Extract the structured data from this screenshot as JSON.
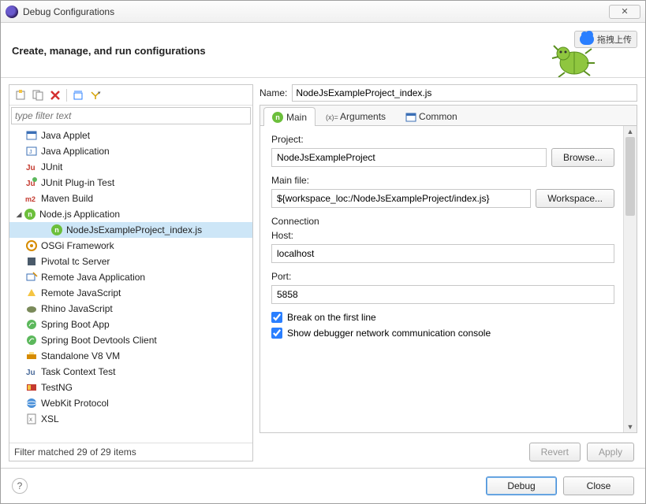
{
  "window": {
    "title": "Debug Configurations",
    "close_x": "✕"
  },
  "header": {
    "title": "Create, manage, and run configurations",
    "cloud_label": "拖拽上传"
  },
  "toolbar": {
    "new_tip": "new",
    "dup_tip": "duplicate",
    "del_tip": "delete",
    "collapse_tip": "collapse",
    "filter_tip": "filter"
  },
  "filter": {
    "placeholder": "type filter text"
  },
  "tree": {
    "items": [
      {
        "label": "Java Applet",
        "icon": "applet"
      },
      {
        "label": "Java Application",
        "icon": "java-app"
      },
      {
        "label": "JUnit",
        "icon": "junit"
      },
      {
        "label": "JUnit Plug-in Test",
        "icon": "junit-plugin"
      },
      {
        "label": "Maven Build",
        "icon": "maven"
      },
      {
        "label": "Node.js Application",
        "icon": "nodejs",
        "expanded": true,
        "children": [
          {
            "label": "NodeJsExampleProject_index.js",
            "icon": "nodejs",
            "selected": true
          }
        ]
      },
      {
        "label": "OSGi Framework",
        "icon": "osgi"
      },
      {
        "label": "Pivotal tc Server",
        "icon": "tcserver"
      },
      {
        "label": "Remote Java Application",
        "icon": "remote-java"
      },
      {
        "label": "Remote JavaScript",
        "icon": "remote-js"
      },
      {
        "label": "Rhino JavaScript",
        "icon": "rhino"
      },
      {
        "label": "Spring Boot App",
        "icon": "spring"
      },
      {
        "label": "Spring Boot Devtools Client",
        "icon": "spring"
      },
      {
        "label": "Standalone V8 VM",
        "icon": "v8"
      },
      {
        "label": "Task Context Test",
        "icon": "task"
      },
      {
        "label": "TestNG",
        "icon": "testng"
      },
      {
        "label": "WebKit Protocol",
        "icon": "webkit"
      },
      {
        "label": "XSL",
        "icon": "xsl"
      }
    ],
    "status": "Filter matched 29 of 29 items"
  },
  "form": {
    "name_label": "Name:",
    "name_value": "NodeJsExampleProject_index.js",
    "tabs": [
      {
        "label": "Main",
        "icon": "nodejs",
        "active": true
      },
      {
        "label": "Arguments",
        "icon": "args"
      },
      {
        "label": "Common",
        "icon": "common"
      }
    ],
    "project": {
      "label": "Project:",
      "value": "NodeJsExampleProject",
      "browse": "Browse..."
    },
    "mainfile": {
      "label": "Main file:",
      "value": "${workspace_loc:/NodeJsExampleProject/index.js}",
      "workspace": "Workspace..."
    },
    "connection": {
      "title": "Connection",
      "host_label": "Host:",
      "host_value": "localhost",
      "port_label": "Port:",
      "port_value": "5858"
    },
    "break_first_line": "Break on the first line",
    "show_debugger_console": "Show debugger network communication console",
    "revert": "Revert",
    "apply": "Apply"
  },
  "footer": {
    "help": "?",
    "debug": "Debug",
    "close": "Close"
  }
}
